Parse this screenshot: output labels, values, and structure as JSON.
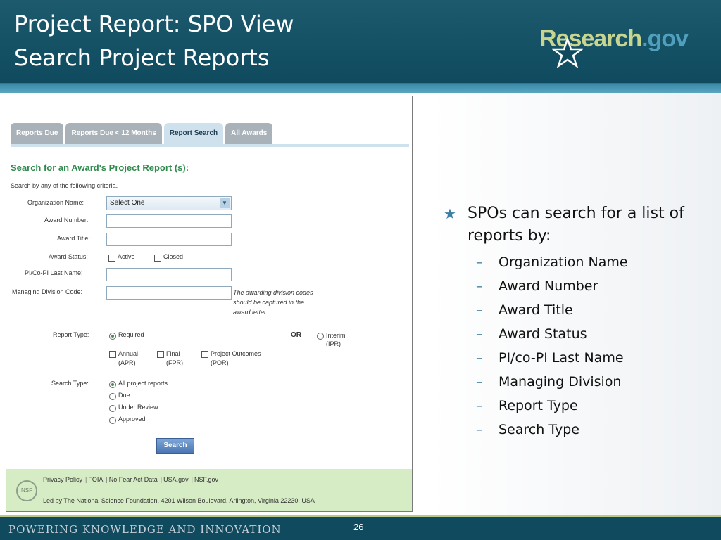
{
  "slide": {
    "title_line1": "Project Report: SPO View",
    "title_line2": "Search Project Reports",
    "page_number": "26",
    "tagline": "POWERING KNOWLEDGE AND INNOVATION"
  },
  "logo": {
    "text_a": "Research",
    "text_b": ".gov"
  },
  "screenshot": {
    "tabs": [
      {
        "label": "Reports Due"
      },
      {
        "label": "Reports Due < 12 Months"
      },
      {
        "label": "Report Search"
      },
      {
        "label": "All Awards"
      }
    ],
    "form_title": "Search for an Award's Project Report (s):",
    "form_subtitle": "Search by any of the following criteria.",
    "labels": {
      "org_name": "Organization Name:",
      "award_number": "Award Number:",
      "award_title": "Award Title:",
      "award_status": "Award Status:",
      "pi_last_name": "PI/Co-PI Last Name:",
      "division_code": "Managing Division Code:",
      "report_type": "Report Type:",
      "search_type": "Search Type:"
    },
    "select_value": "Select One",
    "status_options": {
      "active": "Active",
      "closed": "Closed"
    },
    "division_note": "The awarding division codes should be captured in the award letter.",
    "report_type_options": {
      "required": "Required",
      "or": "OR",
      "interim": "Interim (IPR)",
      "annual": "Annual (APR)",
      "final": "Final (FPR)",
      "outcomes": "Project Outcomes (POR)"
    },
    "search_type_options": {
      "all": "All project reports",
      "due": "Due",
      "under_review": "Under Review",
      "approved": "Approved"
    },
    "search_button": "Search",
    "footer": {
      "seal_text": "NSF",
      "links": [
        "Privacy Policy",
        "FOIA",
        "No Fear Act Data",
        "USA.gov",
        "NSF.gov"
      ],
      "address": "Led by The National Science Foundation, 4201 Wilson Boulevard, Arlington, Virginia 22230, USA"
    }
  },
  "bullets": {
    "main": "SPOs can search for a list of reports by:",
    "items": [
      "Organization Name",
      "Award Number",
      "Award Title",
      "Award Status",
      "PI/co-PI Last Name",
      "Managing Division",
      "Report Type",
      "Search Type"
    ]
  }
}
